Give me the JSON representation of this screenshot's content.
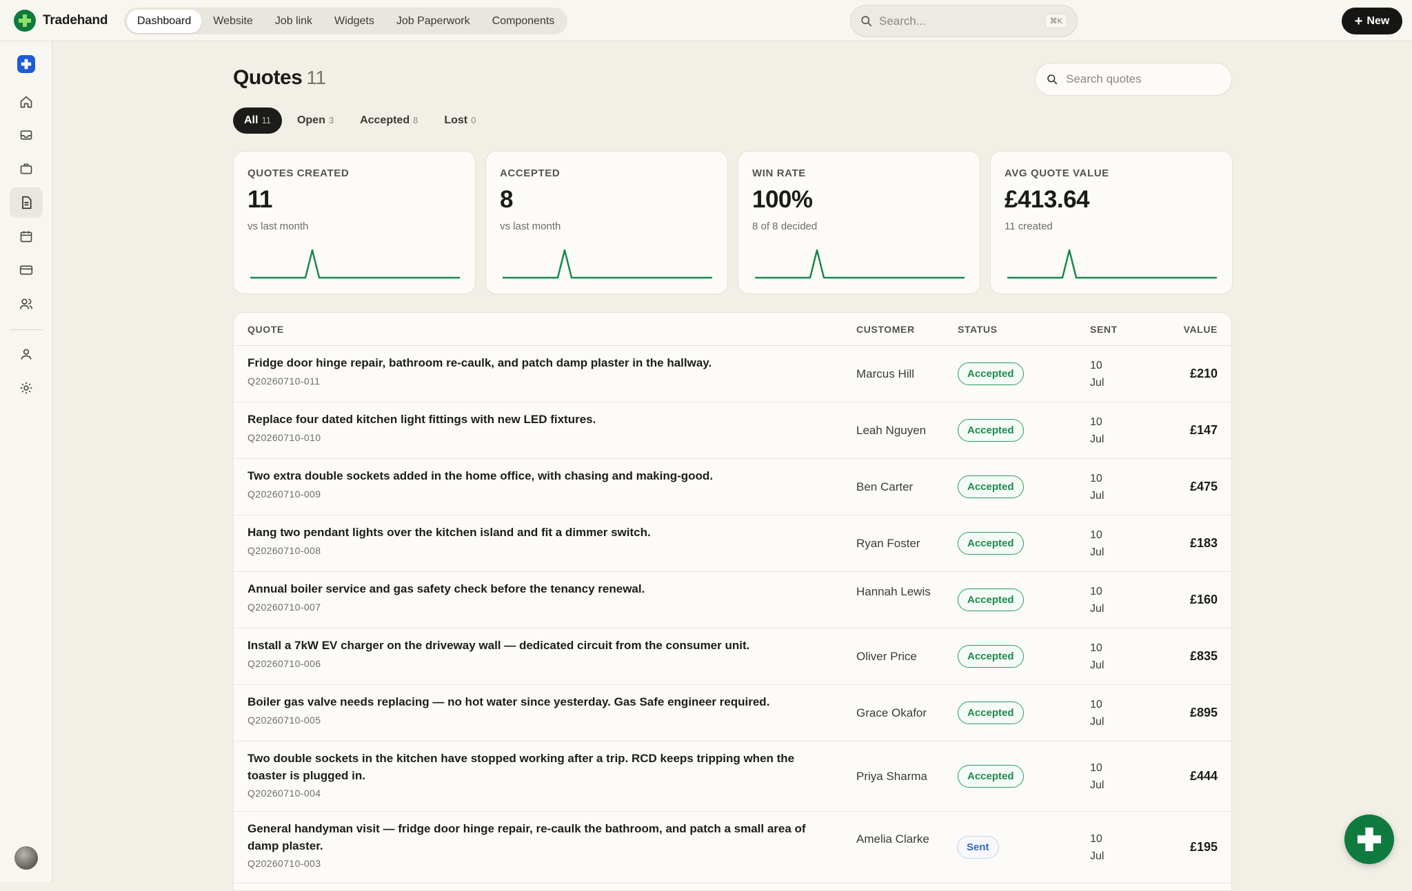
{
  "app": {
    "name": "Tradehand"
  },
  "nav": {
    "tabs": [
      "Dashboard",
      "Website",
      "Job link",
      "Widgets",
      "Job Paperwork",
      "Components"
    ],
    "active": "Dashboard"
  },
  "search": {
    "placeholder": "Search...",
    "shortcut": "⌘K"
  },
  "new_button": {
    "label": "New"
  },
  "sidebar": {
    "items": [
      "home-icon",
      "inbox-icon",
      "briefcase-icon",
      "document-icon",
      "calendar-icon",
      "card-icon",
      "users-icon",
      "user-icon",
      "settings-icon"
    ],
    "active": "document-icon"
  },
  "page": {
    "title": "Quotes",
    "count": "11",
    "search_placeholder": "Search quotes"
  },
  "filters": [
    {
      "label": "All",
      "count": "11",
      "active": true
    },
    {
      "label": "Open",
      "count": "3"
    },
    {
      "label": "Accepted",
      "count": "8"
    },
    {
      "label": "Lost",
      "count": "0"
    }
  ],
  "stats": [
    {
      "label": "QUOTES CREATED",
      "value": "11",
      "sub": "vs last month"
    },
    {
      "label": "ACCEPTED",
      "value": "8",
      "sub": "vs last month"
    },
    {
      "label": "WIN RATE",
      "value": "100%",
      "sub": "8 of 8 decided"
    },
    {
      "label": "AVG QUOTE VALUE",
      "value": "£413.64",
      "sub": "11 created"
    }
  ],
  "table": {
    "headers": {
      "quote": "QUOTE",
      "customer": "CUSTOMER",
      "status": "STATUS",
      "sent": "SENT",
      "value": "VALUE"
    },
    "rows": [
      {
        "title": "Fridge door hinge repair, bathroom re-caulk, and patch damp plaster in the hallway.",
        "id": "Q20260710-011",
        "customer": "Marcus Hill",
        "status": "Accepted",
        "sent_day": "10",
        "sent_month": "Jul",
        "value": "£210"
      },
      {
        "title": "Replace four dated kitchen light fittings with new LED fixtures.",
        "id": "Q20260710-010",
        "customer": "Leah Nguyen",
        "status": "Accepted",
        "sent_day": "10",
        "sent_month": "Jul",
        "value": "£147"
      },
      {
        "title": "Two extra double sockets added in the home office, with chasing and making-good.",
        "id": "Q20260710-009",
        "customer": "Ben Carter",
        "status": "Accepted",
        "sent_day": "10",
        "sent_month": "Jul",
        "value": "£475"
      },
      {
        "title": "Hang two pendant lights over the kitchen island and fit a dimmer switch.",
        "id": "Q20260710-008",
        "customer": "Ryan Foster",
        "status": "Accepted",
        "sent_day": "10",
        "sent_month": "Jul",
        "value": "£183"
      },
      {
        "title": "Annual boiler service and gas safety check before the tenancy renewal.",
        "id": "Q20260710-007",
        "customer": "Hannah Lewis",
        "status": "Accepted",
        "sent_day": "10",
        "sent_month": "Jul",
        "value": "£160"
      },
      {
        "title": "Install a 7kW EV charger on the driveway wall — dedicated circuit from the consumer unit.",
        "id": "Q20260710-006",
        "customer": "Oliver Price",
        "status": "Accepted",
        "sent_day": "10",
        "sent_month": "Jul",
        "value": "£835"
      },
      {
        "title": "Boiler gas valve needs replacing — no hot water since yesterday. Gas Safe engineer required.",
        "id": "Q20260710-005",
        "customer": "Grace Okafor",
        "status": "Accepted",
        "sent_day": "10",
        "sent_month": "Jul",
        "value": "£895"
      },
      {
        "title": "Two double sockets in the kitchen have stopped working after a trip. RCD keeps tripping when the toaster is plugged in.",
        "id": "Q20260710-004",
        "customer": "Priya Sharma",
        "status": "Accepted",
        "sent_day": "10",
        "sent_month": "Jul",
        "value": "£444"
      },
      {
        "title": "General handyman visit — fridge door hinge repair, re-caulk the bathroom, and patch a small area of damp plaster.",
        "id": "Q20260710-003",
        "customer": "Amelia Clarke",
        "status": "Sent",
        "sent_day": "10",
        "sent_month": "Jul",
        "value": "£195"
      }
    ]
  },
  "colors": {
    "brand": "#0f7a3e",
    "accepted": "#1f8a4c",
    "sent": "#3467c7",
    "background": "#f1efe6"
  }
}
